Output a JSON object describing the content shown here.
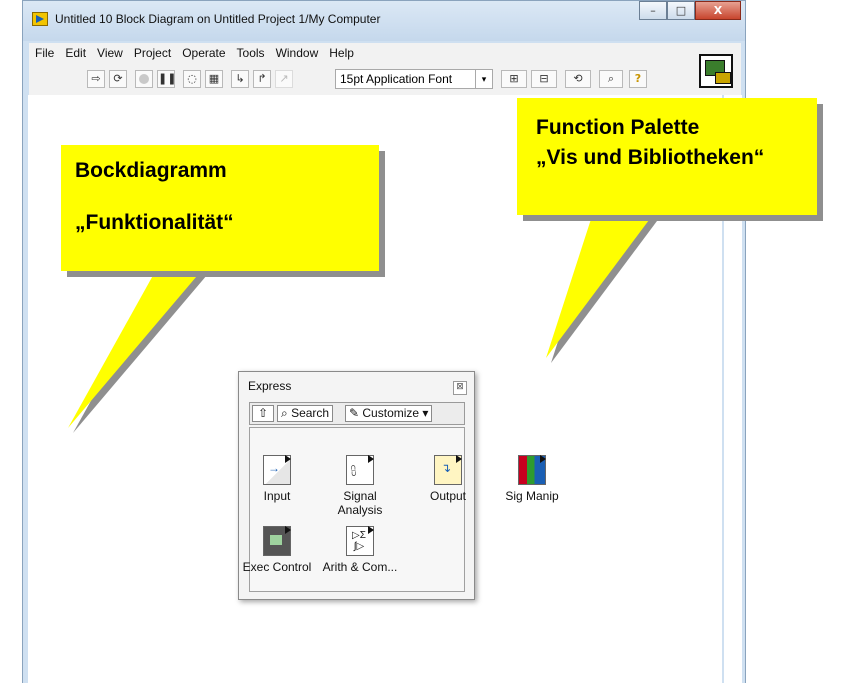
{
  "window": {
    "title": "Untitled 10 Block Diagram on Untitled Project 1/My Computer",
    "minimize": "–",
    "maximize": "□",
    "close": "X"
  },
  "menu": [
    "File",
    "Edit",
    "View",
    "Project",
    "Operate",
    "Tools",
    "Window",
    "Help"
  ],
  "toolbar": {
    "font_select": "15pt Application Font",
    "dropdown_glyph": "▾",
    "help_glyph": "?"
  },
  "callouts": {
    "left": {
      "line1": "Bockdiagramm",
      "line2": "„Funktionalität“"
    },
    "right": {
      "line1": "Function Palette",
      "line2": "„Vis und Bibliotheken“"
    }
  },
  "palette": {
    "title": "Express",
    "close_glyph": "⊠",
    "up_glyph": "⇧",
    "search": "Search",
    "customize": "Customize",
    "items": [
      "Input",
      "Signal Analysis",
      "Output",
      "Sig Manip",
      "Exec Control",
      "Arith & Com..."
    ]
  },
  "colors": {
    "callout": "#ffff00",
    "window_frame": "#cfe0f1"
  }
}
